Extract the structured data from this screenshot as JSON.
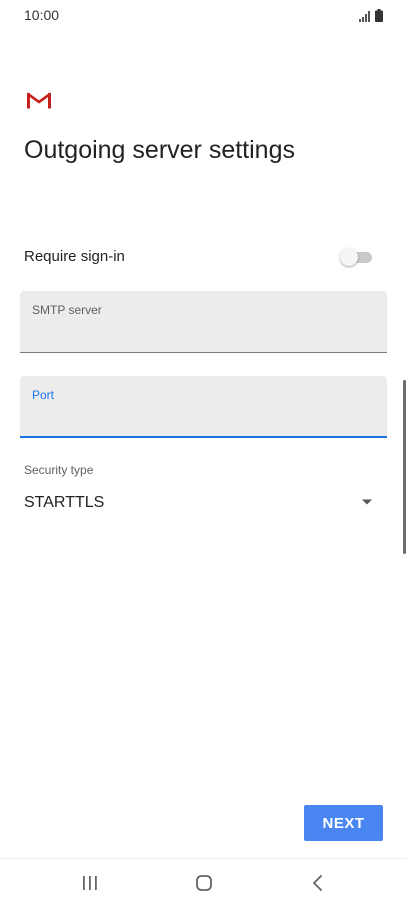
{
  "status_bar": {
    "time": "10:00",
    "signal_icon": "signal-icon",
    "battery_icon": "battery-icon"
  },
  "header": {
    "logo_icon": "gmail-logo-icon",
    "title": "Outgoing server settings"
  },
  "require_signin": {
    "label": "Require sign-in",
    "enabled": false
  },
  "smtp_server": {
    "label": "SMTP server",
    "value": ""
  },
  "port": {
    "label": "Port",
    "value": ""
  },
  "security_type": {
    "label": "Security type",
    "value": "STARTTLS"
  },
  "actions": {
    "next_label": "NEXT"
  },
  "colors": {
    "accent": "#1a73e8",
    "button": "#4a86f2",
    "field_bg": "#ececec",
    "gmail_red": "#d93025"
  },
  "nav_bar": {
    "recent_icon": "recent-apps-icon",
    "home_icon": "home-icon",
    "back_icon": "back-icon"
  }
}
